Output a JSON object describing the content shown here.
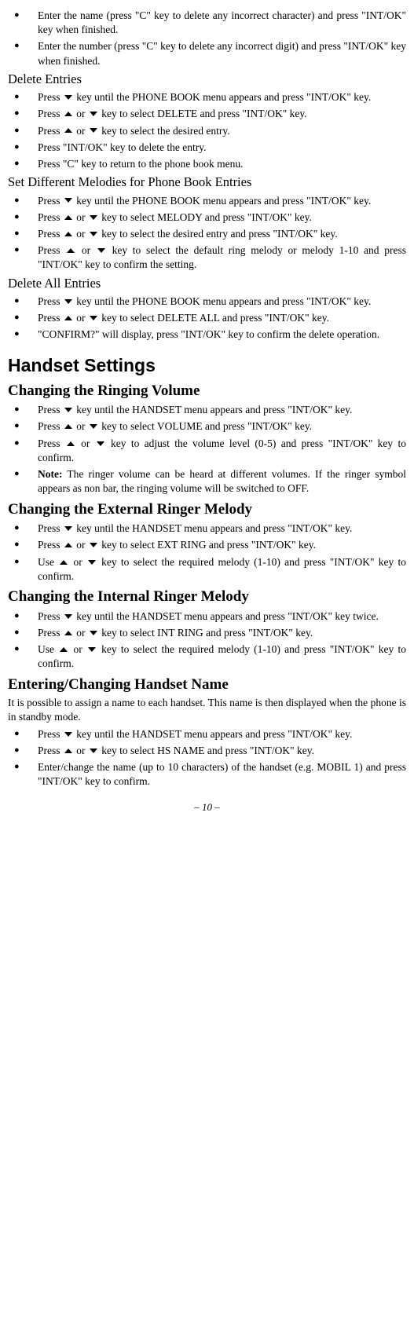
{
  "intro_bullets": [
    "Enter the name (press \"C\" key to delete any incorrect character) and press \"INT/OK\" key when finished.",
    "Enter the number (press \"C\" key to delete any incorrect digit) and press \"INT/OK\" key when finished."
  ],
  "delete_entries": {
    "title": "Delete Entries",
    "b0a": "Press ",
    "b0b": " key until the PHONE BOOK menu appears and press \"INT/OK\" key.",
    "b1a": "Press ",
    "b1b": " or ",
    "b1c": " key to select DELETE and press \"INT/OK\" key.",
    "b2a": "Press ",
    "b2b": " or ",
    "b2c": " key to select the desired entry.",
    "b3": "Press \"INT/OK\" key to delete the entry.",
    "b4": "Press \"C\" key to return to the phone book menu."
  },
  "melodies": {
    "title": "Set Different Melodies for Phone Book Entries",
    "b0a": "Press ",
    "b0b": " key until the PHONE BOOK menu appears and press \"INT/OK\" key.",
    "b1a": "Press ",
    "b1b": " or ",
    "b1c": " key to select MELODY and press \"INT/OK\" key.",
    "b2a": "Press ",
    "b2b": " or ",
    "b2c": " key to select the desired entry and press \"INT/OK\" key.",
    "b3a": "Press ",
    "b3b": " or ",
    "b3c": " key to select the default ring melody or melody 1-10 and press \"INT/OK\" key to confirm the setting."
  },
  "delete_all": {
    "title": "Delete All Entries",
    "b0a": "Press ",
    "b0b": " key until the PHONE BOOK menu appears and press \"INT/OK\" key.",
    "b1a": "Press ",
    "b1b": " or ",
    "b1c": " key to select DELETE ALL and press \"INT/OK\" key.",
    "b2": "\"CONFIRM?\" will display, press \"INT/OK\" key to confirm the delete operation."
  },
  "handset_settings_title": "Handset Settings",
  "ringing_volume": {
    "title": "Changing the Ringing Volume",
    "b0a": "Press ",
    "b0b": " key until the HANDSET menu appears and press \"INT/OK\" key.",
    "b1a": "Press ",
    "b1b": " or ",
    "b1c": " key to select VOLUME and press \"INT/OK\" key.",
    "b2a": "Press ",
    "b2b": " or ",
    "b2c": " key to adjust the volume level (0-5) and press \"INT/OK\" key to confirm.",
    "b3_bold": "Note:",
    "b3_rest": " The ringer volume can be heard at different volumes. If the ringer symbol appears as non bar, the ringing volume will be switched to OFF."
  },
  "ext_ring": {
    "title": "Changing the External Ringer Melody",
    "b0a": "Press ",
    "b0b": " key until the HANDSET menu appears and press \"INT/OK\" key.",
    "b1a": "Press ",
    "b1b": " or ",
    "b1c": " key to select EXT RING and press \"INT/OK\" key.",
    "b2a": "Use ",
    "b2b": " or ",
    "b2c": " key to select the required melody (1-10) and press \"INT/OK\" key to confirm."
  },
  "int_ring": {
    "title": "Changing the Internal Ringer Melody",
    "b0a": "Press ",
    "b0b": " key until the HANDSET menu appears and press \"INT/OK\" key twice.",
    "b1a": "Press ",
    "b1b": " or ",
    "b1c": " key to select INT RING and press \"INT/OK\" key.",
    "b2a": "Use ",
    "b2b": " or ",
    "b2c": " key to select the required melody (1-10) and press \"INT/OK\" key to confirm."
  },
  "hs_name": {
    "title": "Entering/Changing Handset Name",
    "intro": "It is possible to assign a name to each handset. This name is then displayed when the phone is in standby mode.",
    "b0a": "Press ",
    "b0b": " key until the HANDSET menu appears and press \"INT/OK\" key.",
    "b1a": "Press ",
    "b1b": " or ",
    "b1c": " key to select HS NAME and press \"INT/OK\" key.",
    "b2": "Enter/change the name (up to 10 characters) of the handset (e.g. MOBIL 1) and press \"INT/OK\" key to confirm."
  },
  "footer": "– 10 –"
}
